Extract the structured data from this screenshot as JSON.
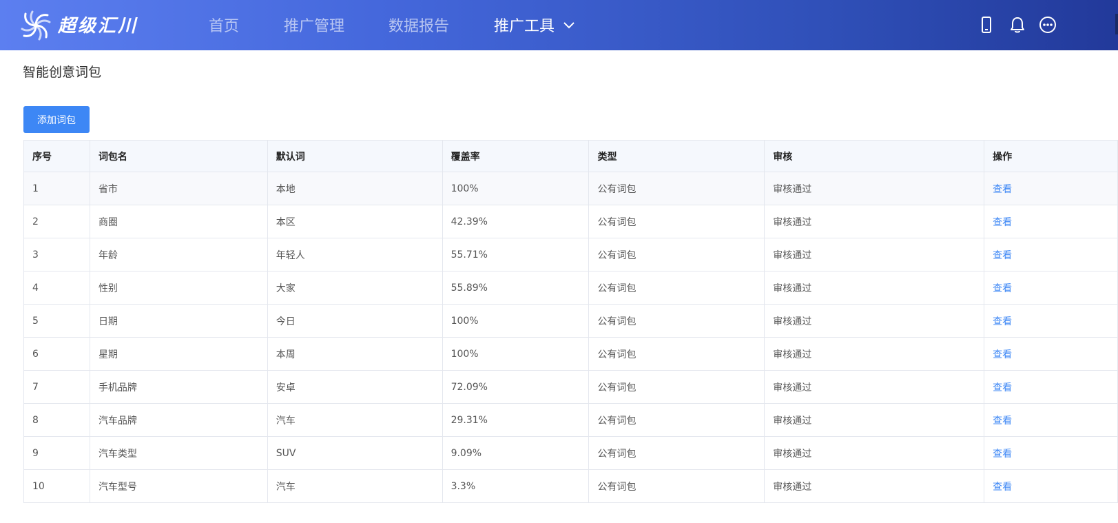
{
  "app": {
    "brand": "超级汇川",
    "colors": {
      "nav_gradient_start": "#5c7ff0",
      "nav_gradient_end": "#22399a",
      "accent": "#3d87f5"
    }
  },
  "nav": {
    "items": [
      {
        "label": "首页"
      },
      {
        "label": "推广管理"
      },
      {
        "label": "数据报告"
      },
      {
        "label": "推广工具"
      }
    ],
    "icons": [
      "mobile-icon",
      "bell-icon",
      "more-icon"
    ]
  },
  "page": {
    "title": "智能创意词包",
    "add_button": "添加词包"
  },
  "table": {
    "headers": [
      "序号",
      "词包名",
      "默认词",
      "覆盖率",
      "类型",
      "审核",
      "操作"
    ],
    "rows": [
      [
        "1",
        "省市",
        "本地",
        "100%",
        "公有词包",
        "审核通过",
        "查看"
      ],
      [
        "2",
        "商圈",
        "本区",
        "42.39%",
        "公有词包",
        "审核通过",
        "查看"
      ],
      [
        "3",
        "年龄",
        "年轻人",
        "55.71%",
        "公有词包",
        "审核通过",
        "查看"
      ],
      [
        "4",
        "性别",
        "大家",
        "55.89%",
        "公有词包",
        "审核通过",
        "查看"
      ],
      [
        "5",
        "日期",
        "今日",
        "100%",
        "公有词包",
        "审核通过",
        "查看"
      ],
      [
        "6",
        "星期",
        "本周",
        "100%",
        "公有词包",
        "审核通过",
        "查看"
      ],
      [
        "7",
        "手机品牌",
        "安卓",
        "72.09%",
        "公有词包",
        "审核通过",
        "查看"
      ],
      [
        "8",
        "汽车品牌",
        "汽车",
        "29.31%",
        "公有词包",
        "审核通过",
        "查看"
      ],
      [
        "9",
        "汽车类型",
        "SUV",
        "9.09%",
        "公有词包",
        "审核通过",
        "查看"
      ],
      [
        "10",
        "汽车型号",
        "汽车",
        "3.3%",
        "公有词包",
        "审核通过",
        "查看"
      ]
    ]
  }
}
